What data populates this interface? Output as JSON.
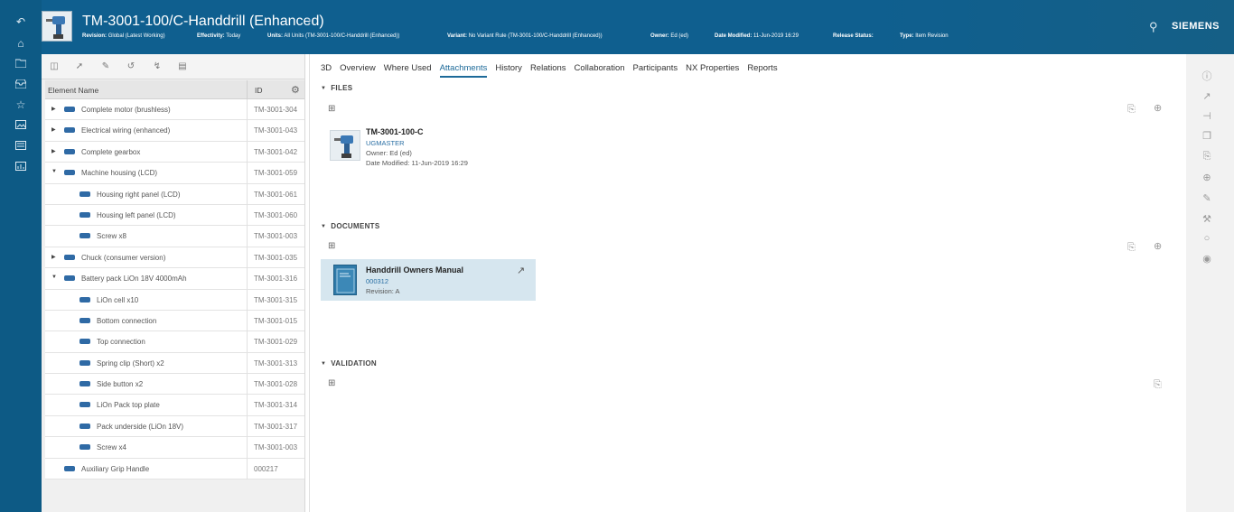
{
  "leftnav": {
    "icons": [
      "back-icon",
      "home-icon",
      "folder-icon",
      "inbox-icon",
      "star-icon",
      "image-icon",
      "form-icon",
      "report-icon"
    ]
  },
  "header": {
    "title": "TM-3001-100/C-Handdrill (Enhanced)",
    "meta": [
      {
        "label": "Revision:",
        "value": "Global (Latest Working)"
      },
      {
        "label": "Effectivity:",
        "value": "Today"
      },
      {
        "label": "Units:",
        "value": "All Units (TM-3001-100/C-Handdrill (Enhanced))"
      },
      {
        "label": "Variant:",
        "value": "No Variant Rule (TM-3001-100/C-Handdrill (Enhanced))"
      },
      {
        "label": "Owner:",
        "value": "Ed (ed)"
      },
      {
        "label": "Date Modified:",
        "value": "11-Jun-2019 16:29"
      },
      {
        "label": "Release Status:",
        "value": ""
      },
      {
        "label": "Type:",
        "value": "Item Revision"
      }
    ],
    "brand": "SIEMENS"
  },
  "tree": {
    "col_name": "Element Name",
    "col_id": "ID",
    "rows": [
      {
        "name": "Complete motor (brushless)",
        "id": "TM-3001-304",
        "toggle": "▶",
        "level": 0
      },
      {
        "name": "Electrical wiring (enhanced)",
        "id": "TM-3001-043",
        "toggle": "▶",
        "level": 0
      },
      {
        "name": "Complete gearbox",
        "id": "TM-3001-042",
        "toggle": "▶",
        "level": 0
      },
      {
        "name": "Machine housing (LCD)",
        "id": "TM-3001-059",
        "toggle": "▼",
        "level": 0
      },
      {
        "name": "Housing right panel (LCD)",
        "id": "TM-3001-061",
        "toggle": "",
        "level": 1
      },
      {
        "name": "Housing left panel (LCD)",
        "id": "TM-3001-060",
        "toggle": "",
        "level": 1
      },
      {
        "name": "Screw x8",
        "id": "TM-3001-003",
        "toggle": "",
        "level": 1
      },
      {
        "name": "Chuck (consumer version)",
        "id": "TM-3001-035",
        "toggle": "▶",
        "level": 0
      },
      {
        "name": "Battery pack LiOn 18V 4000mAh",
        "id": "TM-3001-316",
        "toggle": "▼",
        "level": 0
      },
      {
        "name": "LiOn cell x10",
        "id": "TM-3001-315",
        "toggle": "",
        "level": 1
      },
      {
        "name": "Bottom connection",
        "id": "TM-3001-015",
        "toggle": "",
        "level": 1
      },
      {
        "name": "Top connection",
        "id": "TM-3001-029",
        "toggle": "",
        "level": 1
      },
      {
        "name": "Spring clip (Short) x2",
        "id": "TM-3001-313",
        "toggle": "",
        "level": 1
      },
      {
        "name": "Side button x2",
        "id": "TM-3001-028",
        "toggle": "",
        "level": 1
      },
      {
        "name": "LiOn Pack top plate",
        "id": "TM-3001-314",
        "toggle": "",
        "level": 1
      },
      {
        "name": "Pack underside (LiOn 18V)",
        "id": "TM-3001-317",
        "toggle": "",
        "level": 1
      },
      {
        "name": "Screw x4",
        "id": "TM-3001-003",
        "toggle": "",
        "level": 1
      },
      {
        "name": "Auxiliary Grip Handle",
        "id": "000217",
        "toggle": "",
        "level": 0
      }
    ]
  },
  "tabs": [
    "3D",
    "Overview",
    "Where Used",
    "Attachments",
    "History",
    "Relations",
    "Collaboration",
    "Participants",
    "NX Properties",
    "Reports"
  ],
  "active_tab": "Attachments",
  "files": {
    "heading": "FILES",
    "item": {
      "name": "TM-3001-100-C",
      "type": "UGMASTER",
      "owner_label": "Owner:",
      "owner": "Ed (ed)",
      "date_label": "Date Modified:",
      "date": "11-Jun-2019 16:29"
    }
  },
  "documents": {
    "heading": "DOCUMENTS",
    "item": {
      "name": "Handdrill Owners Manual",
      "number": "000312",
      "rev_label": "Revision:",
      "rev": "A"
    }
  },
  "validation": {
    "heading": "VALIDATION"
  },
  "colors": {
    "header_bg": "#0f5f8f",
    "accent": "#1d6a99",
    "selected_card": "#d6e6ef"
  }
}
